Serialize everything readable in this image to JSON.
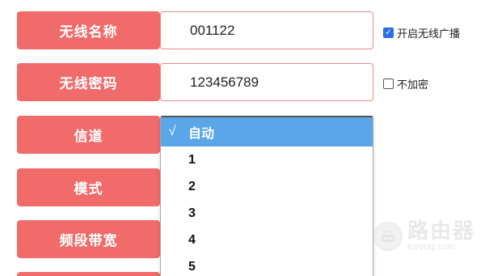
{
  "form": {
    "ssid": {
      "label": "无线名称",
      "value": "001122"
    },
    "password": {
      "label": "无线密码",
      "value": "123456789"
    },
    "channel": {
      "label": "信道"
    },
    "mode": {
      "label": "模式"
    },
    "bandwidth": {
      "label": "频段带宽"
    }
  },
  "options": {
    "broadcast": {
      "label": "开启无线广播",
      "checked": true
    },
    "no_encrypt": {
      "label": "不加密",
      "checked": false
    }
  },
  "channel_dropdown": {
    "items": [
      {
        "label": "自动",
        "selected": true,
        "check": "√"
      },
      {
        "label": "1"
      },
      {
        "label": "2"
      },
      {
        "label": "3"
      },
      {
        "label": "4"
      },
      {
        "label": "5"
      }
    ]
  },
  "watermark": {
    "cn": "路由器",
    "en": "luyouqi.com"
  },
  "colors": {
    "label_bg": "#f26b6b",
    "field_border": "#f08a8a",
    "dropdown_selected": "#5aa6e8"
  }
}
